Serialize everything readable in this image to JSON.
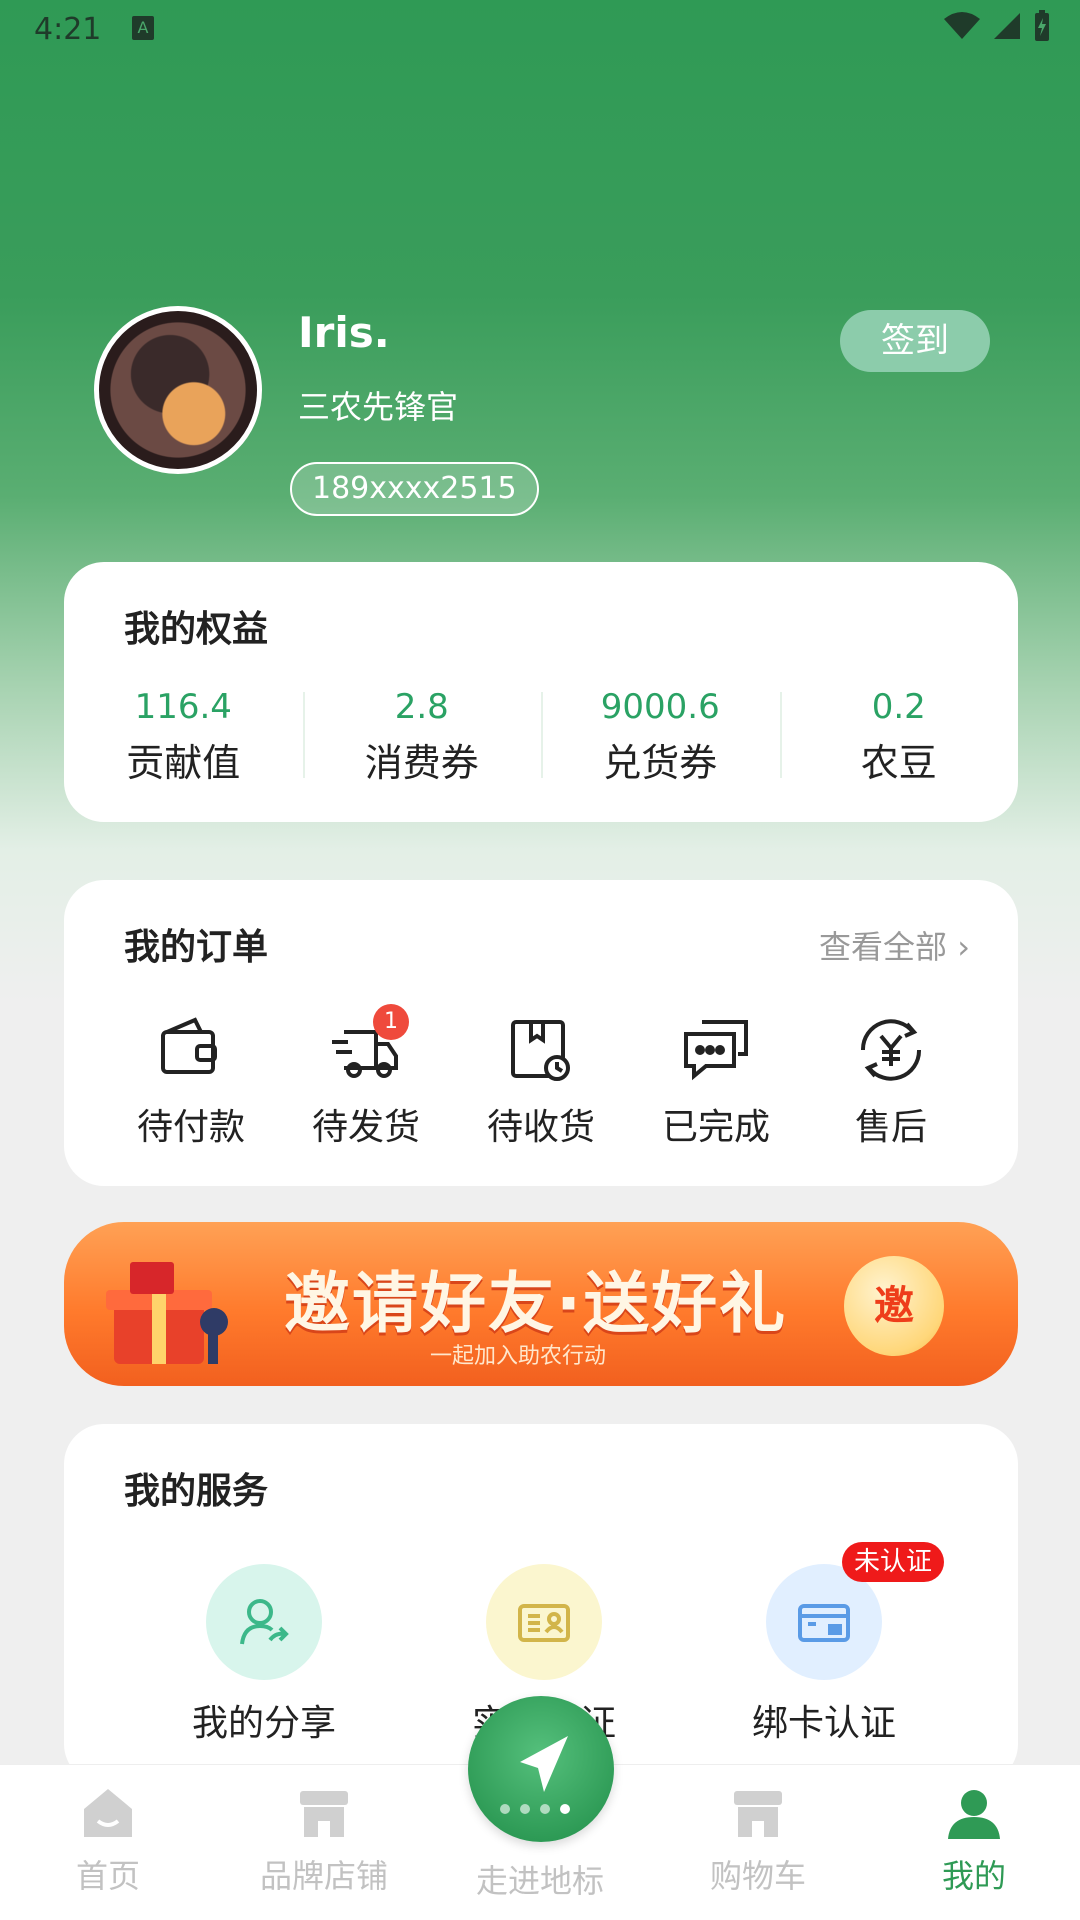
{
  "status_bar": {
    "time": "4:21",
    "indicator": "A"
  },
  "profile": {
    "username": "Iris.",
    "title": "三农先锋官",
    "phone": "189xxxx2515",
    "checkin_label": "签到"
  },
  "benefits": {
    "title": "我的权益",
    "items": [
      {
        "value": "116.4",
        "label": "贡献值"
      },
      {
        "value": "2.8",
        "label": "消费券"
      },
      {
        "value": "9000.6",
        "label": "兑货券"
      },
      {
        "value": "0.2",
        "label": "农豆"
      }
    ]
  },
  "orders": {
    "title": "我的订单",
    "view_all": "查看全部",
    "items": [
      {
        "label": "待付款",
        "icon": "wallet-icon"
      },
      {
        "label": "待发货",
        "icon": "delivery-truck-icon",
        "badge": "1"
      },
      {
        "label": "待收货",
        "icon": "package-clock-icon"
      },
      {
        "label": "已完成",
        "icon": "chat-bubbles-icon"
      },
      {
        "label": "售后",
        "icon": "yen-refresh-icon"
      }
    ]
  },
  "banner": {
    "title": "邀请好友·送好礼",
    "subtitle": "一起加入助农行动",
    "button": "邀"
  },
  "services": {
    "title": "我的服务",
    "items": [
      {
        "label": "我的分享",
        "icon": "share-user-icon",
        "color": "#d8f5ec"
      },
      {
        "label": "实名认证",
        "icon": "id-card-icon",
        "color": "#fbf6cf"
      },
      {
        "label": "绑卡认证",
        "icon": "bank-card-icon",
        "color": "#e1efff",
        "tag": "未认证"
      }
    ]
  },
  "tabbar": {
    "items": [
      {
        "label": "首页",
        "icon": "home-icon"
      },
      {
        "label": "品牌店铺",
        "icon": "store-icon"
      },
      {
        "label": "走进地标",
        "icon": "navigation-arrow-icon"
      },
      {
        "label": "购物车",
        "icon": "cart-store-icon"
      },
      {
        "label": "我的",
        "icon": "person-icon",
        "active": true
      }
    ]
  },
  "colors": {
    "brand_green": "#2f9a55",
    "value_green": "#2aa264",
    "banner_orange": "#ff7a2c",
    "alert_red": "#ef1a1a"
  }
}
